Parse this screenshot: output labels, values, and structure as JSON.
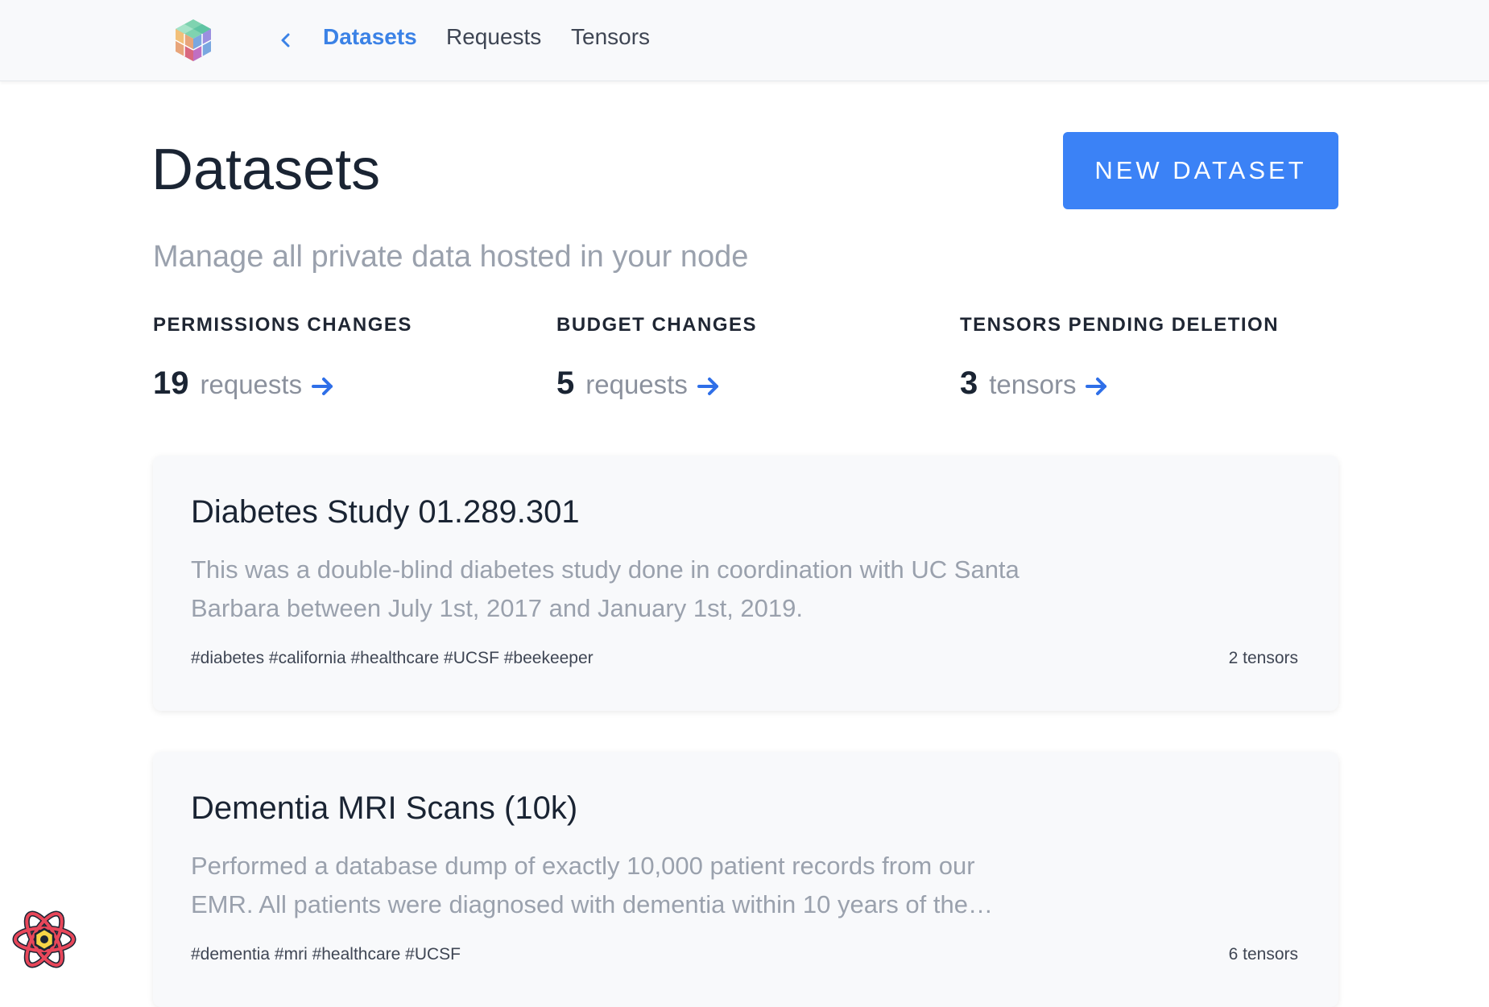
{
  "nav": {
    "links": [
      {
        "label": "Datasets",
        "active": true
      },
      {
        "label": "Requests",
        "active": false
      },
      {
        "label": "Tensors",
        "active": false
      }
    ],
    "logo_icon": "cube-logo-icon",
    "back_icon": "chevron-left-icon"
  },
  "header": {
    "title": "Datasets",
    "new_button_label": "NEW DATASET",
    "subtitle": "Manage all private data hosted in your node"
  },
  "stats": [
    {
      "label": "PERMISSIONS CHANGES",
      "value": "19",
      "unit": "requests"
    },
    {
      "label": "BUDGET CHANGES",
      "value": "5",
      "unit": "requests"
    },
    {
      "label": "TENSORS PENDING DELETION",
      "value": "3",
      "unit": "tensors"
    }
  ],
  "datasets": [
    {
      "title": "Diabetes Study 01.289.301",
      "description": "This was a double-blind diabetes study done in coordination with UC Santa Barbara between July 1st, 2017 and January 1st, 2019.",
      "tags": "#diabetes #california #healthcare #UCSF #beekeeper",
      "count": "2 tensors"
    },
    {
      "title": "Dementia MRI Scans (10k)",
      "description": "Performed a database dump of exactly 10,000 patient records from our EMR. All patients were diagnosed with dementia within 10 years of the…",
      "tags": "#dementia #mri #healthcare #UCSF",
      "count": "6 tensors"
    }
  ],
  "colors": {
    "accent": "#3b82f6",
    "nav_active": "#3b82e6",
    "text_dark": "#1a2433",
    "text_muted": "#9aa1ad"
  }
}
